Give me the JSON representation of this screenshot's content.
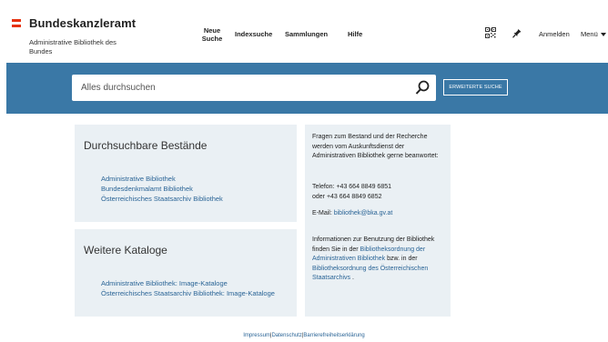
{
  "brand": {
    "title": "Bundeskanzleramt",
    "subtitle": "Administrative Bibliothek des Bundes",
    "flag_colors": [
      "#e6320f",
      "#ffffff",
      "#e6320f"
    ]
  },
  "nav": {
    "neue_suche": "Neue Suche",
    "indexsuche": "Indexsuche",
    "sammlungen": "Sammlungen",
    "hilfe": "Hilfe",
    "qr_icon": "qr-code-icon",
    "pin_icon": "pin-icon",
    "anmelden": "Anmelden",
    "menu": "Menü"
  },
  "search": {
    "placeholder": "Alles durchsuchen",
    "value": "",
    "advanced_label": "ERWEITERTE SUCHE",
    "band_color": "#3a78a6"
  },
  "bestaende": {
    "title": "Durchsuchbare Bestände",
    "links": [
      "Administrative Bibliothek",
      "Bundesdenkmalamt Bibliothek",
      "Österreichisches Staatsarchiv Bibliothek"
    ]
  },
  "kataloge": {
    "title": "Weitere Kataloge",
    "links": [
      "Administrative Bibliothek: Image-Kataloge",
      "Österreichisches Staatsarchiv Bibliothek: Image-Kataloge"
    ]
  },
  "info": {
    "intro": "Fragen zum Bestand und der Recherche werden vom Auskunftsdienst der Administrativen Bibliothek gerne beanwortet:",
    "phone1": "Telefon: +43 664 8849 6851",
    "phone2": "oder +43 664 8849 6852",
    "email_label": "E-Mail: ",
    "email": "bibliothek@bka.gv.at",
    "usage_intro": "Informationen zur Benutzung der Bibliothek finden Sie in der",
    "usage_link1": "Bibliotheksordnung der Administrativen Bibliothek",
    "usage_mid": " bzw. in der",
    "usage_link2": "Bibliotheksordnung des Österreichischen Staatsarchivs",
    "usage_end": " ."
  },
  "footer": {
    "impressum": "Impressum",
    "datenschutz": "Datenschutz",
    "barriere": "Barrierefreiheitserklärung",
    "separator": "|"
  }
}
